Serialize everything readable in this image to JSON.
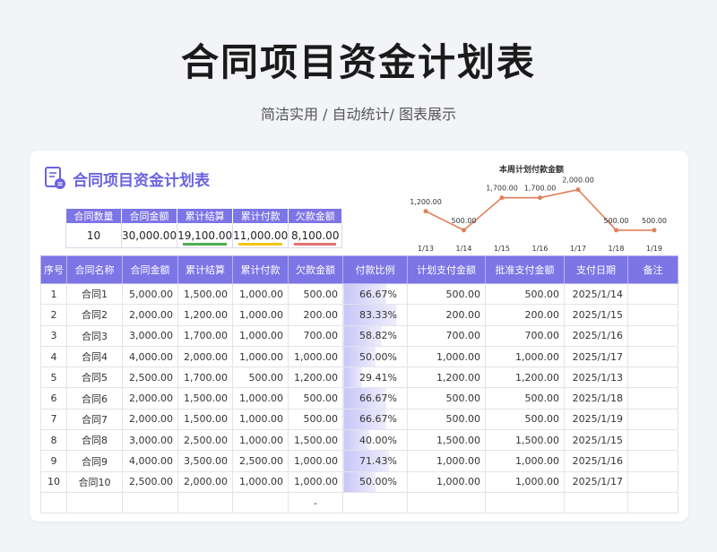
{
  "page": {
    "title": "合同项目资金计划表",
    "subtitle": "简洁实用 / 自动统计/ 图表展示"
  },
  "card": {
    "title": "合同项目资金计划表",
    "logo_icon": "document-logo-icon"
  },
  "summary": {
    "headers": [
      "合同数量",
      "合同金额",
      "累计结算",
      "累计付款",
      "欠款金额"
    ],
    "values": [
      "10",
      "30,000.00",
      "19,100.00",
      "11,000.00",
      "8,100.00"
    ],
    "bar_colors": [
      "",
      "",
      "#4caf50",
      "#f5c518",
      "#e57373"
    ]
  },
  "colors": {
    "accent": "#7b75e6",
    "title_purple": "#6a63e0",
    "line": "#e0805a",
    "pct_bar": "#c9c6f7"
  },
  "chart_data": {
    "type": "line",
    "title": "本周计划付款金额",
    "x": [
      "1/13",
      "1/14",
      "1/15",
      "1/16",
      "1/17",
      "1/18",
      "1/19"
    ],
    "values": [
      1200,
      500,
      1700,
      1700,
      2000,
      500,
      500
    ],
    "labels": [
      "1,200.00",
      "500.00",
      "1,700.00",
      "1,700.00",
      "2,000.00",
      "500.00",
      "500.00"
    ],
    "ylim": [
      0,
      2400
    ]
  },
  "table": {
    "headers": [
      "序号",
      "合同名称",
      "合同金额",
      "累计结算",
      "累计付款",
      "欠款金额",
      "付款比例",
      "计划支付金额",
      "批准支付金额",
      "支付日期",
      "备注"
    ],
    "rows": [
      [
        "1",
        "合同1",
        "5,000.00",
        "1,500.00",
        "1,000.00",
        "500.00",
        "66.67%",
        "500.00",
        "500.00",
        "2025/1/14",
        ""
      ],
      [
        "2",
        "合同2",
        "2,000.00",
        "1,200.00",
        "1,000.00",
        "200.00",
        "83.33%",
        "200.00",
        "200.00",
        "2025/1/15",
        ""
      ],
      [
        "3",
        "合同3",
        "3,000.00",
        "1,700.00",
        "1,000.00",
        "700.00",
        "58.82%",
        "700.00",
        "700.00",
        "2025/1/16",
        ""
      ],
      [
        "4",
        "合同4",
        "4,000.00",
        "2,000.00",
        "1,000.00",
        "1,000.00",
        "50.00%",
        "1,000.00",
        "1,000.00",
        "2025/1/17",
        ""
      ],
      [
        "5",
        "合同5",
        "2,500.00",
        "1,700.00",
        "500.00",
        "1,200.00",
        "29.41%",
        "1,200.00",
        "1,200.00",
        "2025/1/13",
        ""
      ],
      [
        "6",
        "合同6",
        "2,000.00",
        "1,500.00",
        "1,000.00",
        "500.00",
        "66.67%",
        "500.00",
        "500.00",
        "2025/1/18",
        ""
      ],
      [
        "7",
        "合同7",
        "2,000.00",
        "1,500.00",
        "1,000.00",
        "500.00",
        "66.67%",
        "500.00",
        "500.00",
        "2025/1/19",
        ""
      ],
      [
        "8",
        "合同8",
        "3,000.00",
        "2,500.00",
        "1,000.00",
        "1,500.00",
        "40.00%",
        "1,500.00",
        "1,500.00",
        "2025/1/15",
        ""
      ],
      [
        "9",
        "合同9",
        "4,000.00",
        "3,500.00",
        "2,500.00",
        "1,000.00",
        "71.43%",
        "1,000.00",
        "1,000.00",
        "2025/1/16",
        ""
      ],
      [
        "10",
        "合同10",
        "2,500.00",
        "2,000.00",
        "1,000.00",
        "1,000.00",
        "50.00%",
        "1,000.00",
        "1,000.00",
        "2025/1/17",
        ""
      ],
      [
        "",
        "",
        "",
        "",
        "",
        "-",
        "",
        "",
        "",
        "",
        ""
      ]
    ],
    "pct_values": [
      0.6667,
      0.8333,
      0.5882,
      0.5,
      0.2941,
      0.6667,
      0.6667,
      0.4,
      0.7143,
      0.5,
      0
    ]
  }
}
